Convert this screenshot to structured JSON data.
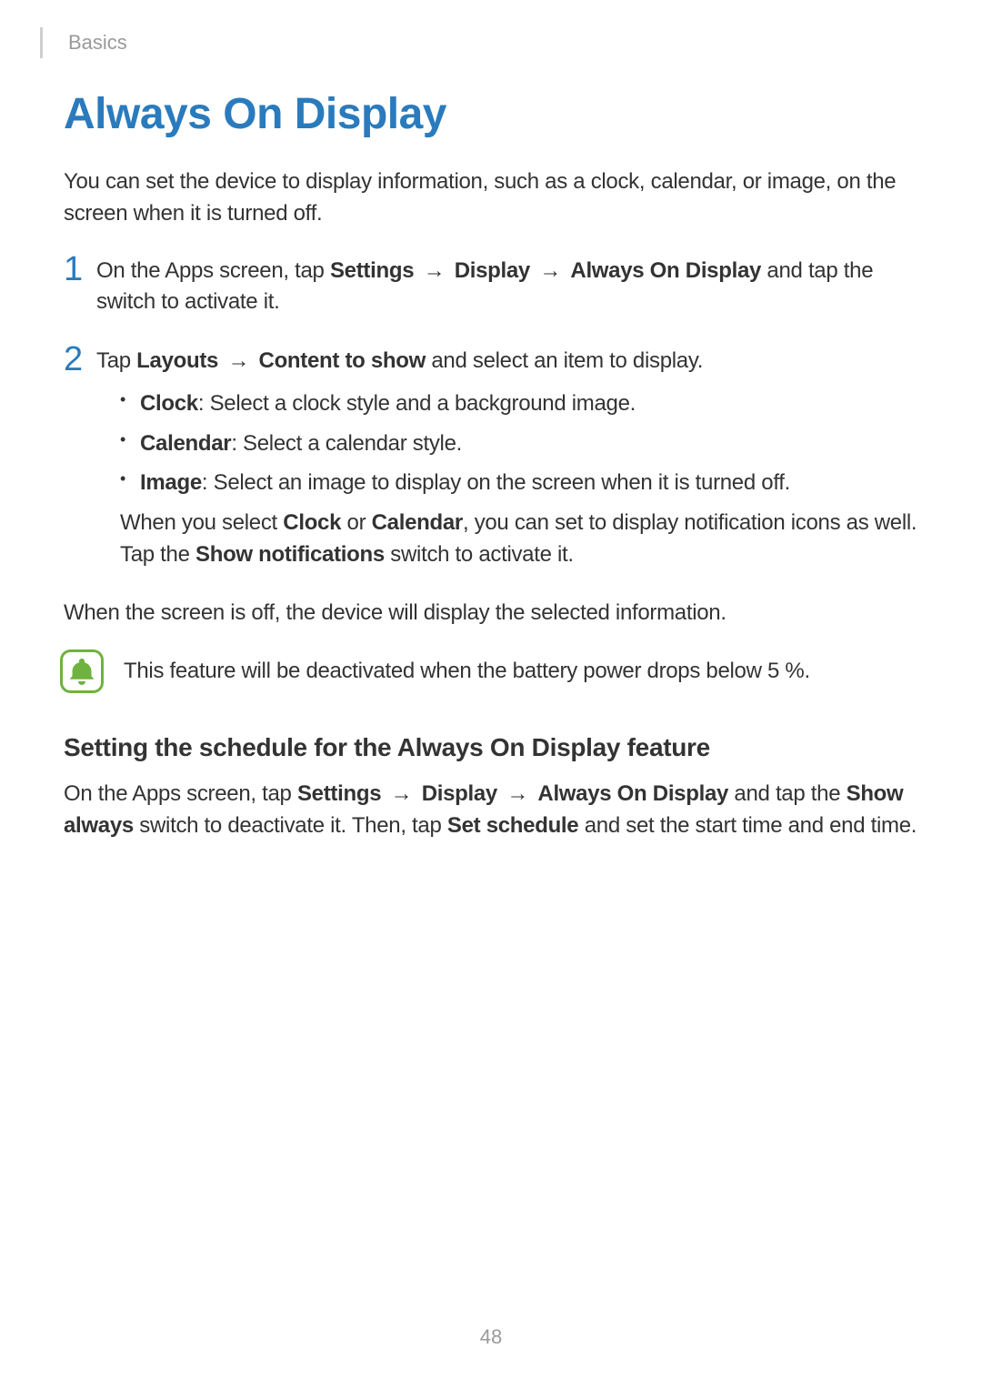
{
  "header": {
    "section": "Basics"
  },
  "title": "Always On Display",
  "intro": "You can set the device to display information, such as a clock, calendar, or image, on the screen when it is turned off.",
  "steps": {
    "s1": {
      "num": "1",
      "pre": "On the Apps screen, tap ",
      "b1": "Settings",
      "arr1": " → ",
      "b2": "Display",
      "arr2": " → ",
      "b3": "Always On Display",
      "post": " and tap the switch to activate it."
    },
    "s2": {
      "num": "2",
      "pre": "Tap ",
      "b1": "Layouts",
      "arr1": " → ",
      "b2": "Content to show",
      "post": " and select an item to display.",
      "items": {
        "clock": {
          "label": "Clock",
          "desc": ": Select a clock style and a background image."
        },
        "calendar": {
          "label": "Calendar",
          "desc": ": Select a calendar style."
        },
        "image": {
          "label": "Image",
          "desc": ": Select an image to display on the screen when it is turned off."
        }
      },
      "subnote": {
        "pre": "When you select ",
        "b1": "Clock",
        "mid1": " or ",
        "b2": "Calendar",
        "mid2": ", you can set to display notification icons as well. Tap the ",
        "b3": "Show notifications",
        "post": " switch to activate it."
      }
    }
  },
  "after": "When the screen is off, the device will display the selected information.",
  "note": "This feature will be deactivated when the battery power drops below 5 %.",
  "subhead": "Setting the schedule for the Always On Display feature",
  "schedule": {
    "pre": "On the Apps screen, tap ",
    "b1": "Settings",
    "arr1": " → ",
    "b2": "Display",
    "arr2": " → ",
    "b3": "Always On Display",
    "mid1": " and tap the ",
    "b4": "Show always",
    "mid2": " switch to deactivate it. Then, tap ",
    "b5": "Set schedule",
    "post": " and set the start time and end time."
  },
  "page_number": "48"
}
